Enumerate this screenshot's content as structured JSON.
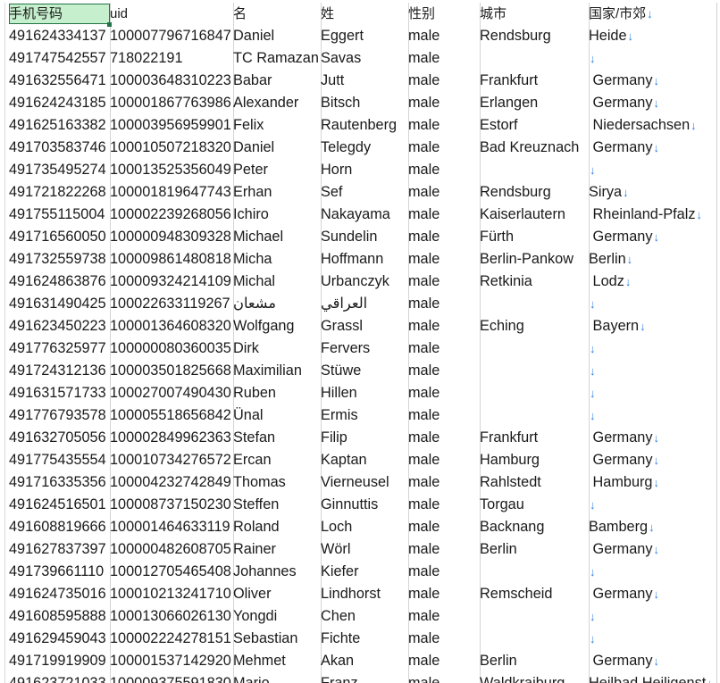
{
  "headers": [
    "手机号码",
    "uid",
    "名",
    "姓",
    "性别",
    "城市",
    "国家/市郊"
  ],
  "header_filter_arrow": "↓",
  "rows": [
    [
      "491624334137",
      "100007796716847",
      "Daniel",
      "Eggert",
      "male",
      "Rendsburg",
      "Heide"
    ],
    [
      "491747542557",
      "718022191",
      "TC Ramazan",
      "Savas",
      "male",
      "",
      ""
    ],
    [
      "491632556471",
      "100003648310223",
      "Babar",
      "Jutt",
      "male",
      "Frankfurt",
      " Germany"
    ],
    [
      "491624243185",
      "100001867763986",
      "Alexander",
      "Bitsch",
      "male",
      "Erlangen",
      " Germany"
    ],
    [
      "491625163382",
      "100003956959901",
      "Felix",
      "Rautenberg",
      "male",
      "Estorf",
      " Niedersachsen"
    ],
    [
      "491703583746",
      "100010507218320",
      "Daniel",
      "Telegdy",
      "male",
      "Bad Kreuznach",
      " Germany"
    ],
    [
      "491735495274",
      "100013525356049",
      "Peter",
      "Horn",
      "male",
      "",
      ""
    ],
    [
      "491721822268",
      "100001819647743",
      "Erhan",
      "Sef",
      "male",
      "Rendsburg",
      "Sirya"
    ],
    [
      "491755115004",
      "100002239268056",
      "Ichiro",
      "Nakayama",
      "male",
      "Kaiserlautern",
      " Rheinland-Pfalz"
    ],
    [
      "491716560050",
      "100000948309328",
      "Michael",
      "Sundelin",
      "male",
      "Fürth",
      " Germany"
    ],
    [
      "491732559738",
      "100009861480818",
      "Micha",
      "Hoffmann",
      "male",
      "Berlin-Pankow",
      "Berlin"
    ],
    [
      "491624863876",
      "100009324214109",
      "Michal",
      "Urbanczyk",
      "male",
      "Retkinia",
      " Lodz"
    ],
    [
      "491631490425",
      "100022633119267",
      "مشعان",
      "العراقي",
      "male",
      "",
      ""
    ],
    [
      "491623450223",
      "100001364608320",
      "Wolfgang",
      "Grassl",
      "male",
      "Eching",
      " Bayern"
    ],
    [
      "491776325977",
      "100000080360035",
      "Dirk",
      "Fervers",
      "male",
      "",
      ""
    ],
    [
      "491724312136",
      "100003501825668",
      "Maximilian",
      "Stüwe",
      "male",
      "",
      ""
    ],
    [
      "491631571733",
      "100027007490430",
      "Ruben",
      "Hillen",
      "male",
      "",
      ""
    ],
    [
      "491776793578",
      "100005518656842",
      "Ünal",
      "Ermis",
      "male",
      "",
      ""
    ],
    [
      "491632705056",
      "100002849962363",
      "Stefan",
      "Filip",
      "male",
      "Frankfurt",
      " Germany"
    ],
    [
      "491775435554",
      "100010734276572",
      "Ercan",
      "Kaptan",
      "male",
      "Hamburg",
      " Germany"
    ],
    [
      "491716335356",
      "100004232742849",
      "Thomas",
      "Vierneusel",
      "male",
      "Rahlstedt",
      " Hamburg"
    ],
    [
      "491624516501",
      "100008737150230",
      "Steffen",
      "Ginnuttis",
      "male",
      "Torgau",
      ""
    ],
    [
      "491608819666",
      "100001464633119",
      "Roland",
      "Loch",
      "male",
      "Backnang",
      "Bamberg"
    ],
    [
      "491627837397",
      "100000482608705",
      "Rainer",
      "Wörl",
      "male",
      "Berlin",
      " Germany"
    ],
    [
      "491739661110",
      "100012705465408",
      "Johannes",
      "Kiefer",
      "male",
      "",
      ""
    ],
    [
      "491624735016",
      "100010213241710",
      "Oliver",
      "Lindhorst",
      "male",
      "Remscheid",
      " Germany"
    ],
    [
      "491608595888",
      "100013066026130",
      "Yongdi",
      "Chen",
      "male",
      "",
      ""
    ],
    [
      "491629459043",
      "100002224278151",
      "Sebastian",
      "Fichte",
      "male",
      "",
      ""
    ],
    [
      "491719919909",
      "100001537142920",
      "Mehmet",
      "Akan",
      "male",
      "Berlin",
      " Germany"
    ],
    [
      "491623721033",
      "100009375591830",
      "Mario",
      "Franz",
      "male",
      "Waldkraiburg",
      "Heilbad Heiligenst"
    ]
  ]
}
